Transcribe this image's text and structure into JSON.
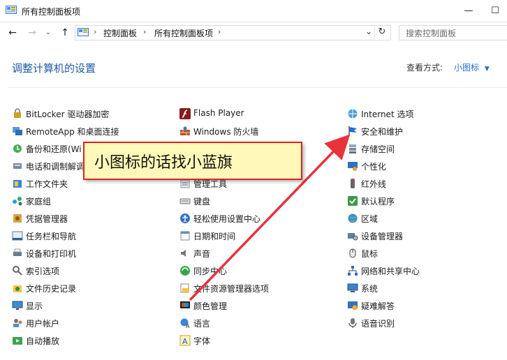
{
  "window": {
    "title": "所有控制面板项"
  },
  "nav": {
    "breadcrumbs": [
      "控制面板",
      "所有控制面板项"
    ],
    "search_placeholder": "搜索控制面板"
  },
  "header": {
    "title": "调整计算机的设置",
    "viewby_label": "查看方式:",
    "viewby_value": "小图标"
  },
  "items": [
    [
      {
        "label": "BitLocker 驱动器加密",
        "icon": "bitlocker-icon"
      },
      {
        "label": "RemoteApp 和桌面连接",
        "icon": "remoteapp-icon"
      },
      {
        "label": "备份和还原(Wi",
        "icon": "backup-restore-icon"
      },
      {
        "label": "电话和调制解调",
        "icon": "phone-modem-icon"
      },
      {
        "label": "工作文件夹",
        "icon": "work-folders-icon"
      },
      {
        "label": "家庭组",
        "icon": "homegroup-icon"
      },
      {
        "label": "凭据管理器",
        "icon": "credential-manager-icon"
      },
      {
        "label": "任务栏和导航",
        "icon": "taskbar-icon"
      },
      {
        "label": "设备和打印机",
        "icon": "devices-printers-icon"
      },
      {
        "label": "索引选项",
        "icon": "indexing-icon"
      },
      {
        "label": "文件历史记录",
        "icon": "file-history-icon"
      },
      {
        "label": "显示",
        "icon": "display-icon"
      },
      {
        "label": "用户帐户",
        "icon": "user-accounts-icon"
      },
      {
        "label": "自动播放",
        "icon": "autoplay-icon"
      }
    ],
    [
      {
        "label": "Flash Player",
        "icon": "flash-icon"
      },
      {
        "label": "Windows 防火墙",
        "icon": "firewall-icon"
      },
      {
        "label": "",
        "icon": ""
      },
      {
        "label": "",
        "icon": ""
      },
      {
        "label": "管理工具",
        "icon": "admin-tools-icon"
      },
      {
        "label": "键盘",
        "icon": "keyboard-icon"
      },
      {
        "label": "轻松使用设置中心",
        "icon": "ease-of-access-icon"
      },
      {
        "label": "日期和时间",
        "icon": "date-time-icon"
      },
      {
        "label": "声音",
        "icon": "sound-icon"
      },
      {
        "label": "同步中心",
        "icon": "sync-center-icon"
      },
      {
        "label": "文件资源管理器选项",
        "icon": "explorer-options-icon"
      },
      {
        "label": "颜色管理",
        "icon": "color-management-icon"
      },
      {
        "label": "语言",
        "icon": "language-icon"
      },
      {
        "label": "字体",
        "icon": "fonts-icon"
      }
    ],
    [
      {
        "label": "Internet 选项",
        "icon": "internet-options-icon"
      },
      {
        "label": "安全和维护",
        "icon": "security-maintenance-flag-icon"
      },
      {
        "label": "存储空间",
        "icon": "storage-spaces-icon"
      },
      {
        "label": "个性化",
        "icon": "personalization-icon"
      },
      {
        "label": "红外线",
        "icon": "infrared-icon"
      },
      {
        "label": "默认程序",
        "icon": "default-programs-icon"
      },
      {
        "label": "区域",
        "icon": "region-icon"
      },
      {
        "label": "设备管理器",
        "icon": "device-manager-icon"
      },
      {
        "label": "鼠标",
        "icon": "mouse-icon"
      },
      {
        "label": "网络和共享中心",
        "icon": "network-sharing-icon"
      },
      {
        "label": "系统",
        "icon": "system-icon"
      },
      {
        "label": "疑难解答",
        "icon": "troubleshooting-icon"
      },
      {
        "label": "语音识别",
        "icon": "speech-recognition-icon"
      }
    ]
  ],
  "callout": {
    "text": "小图标的话找小蓝旗"
  },
  "colors": {
    "link": "#1e5aa8",
    "callout_border": "#e02020",
    "callout_fill": "#fff8b8",
    "arrow": "#e8333a"
  }
}
